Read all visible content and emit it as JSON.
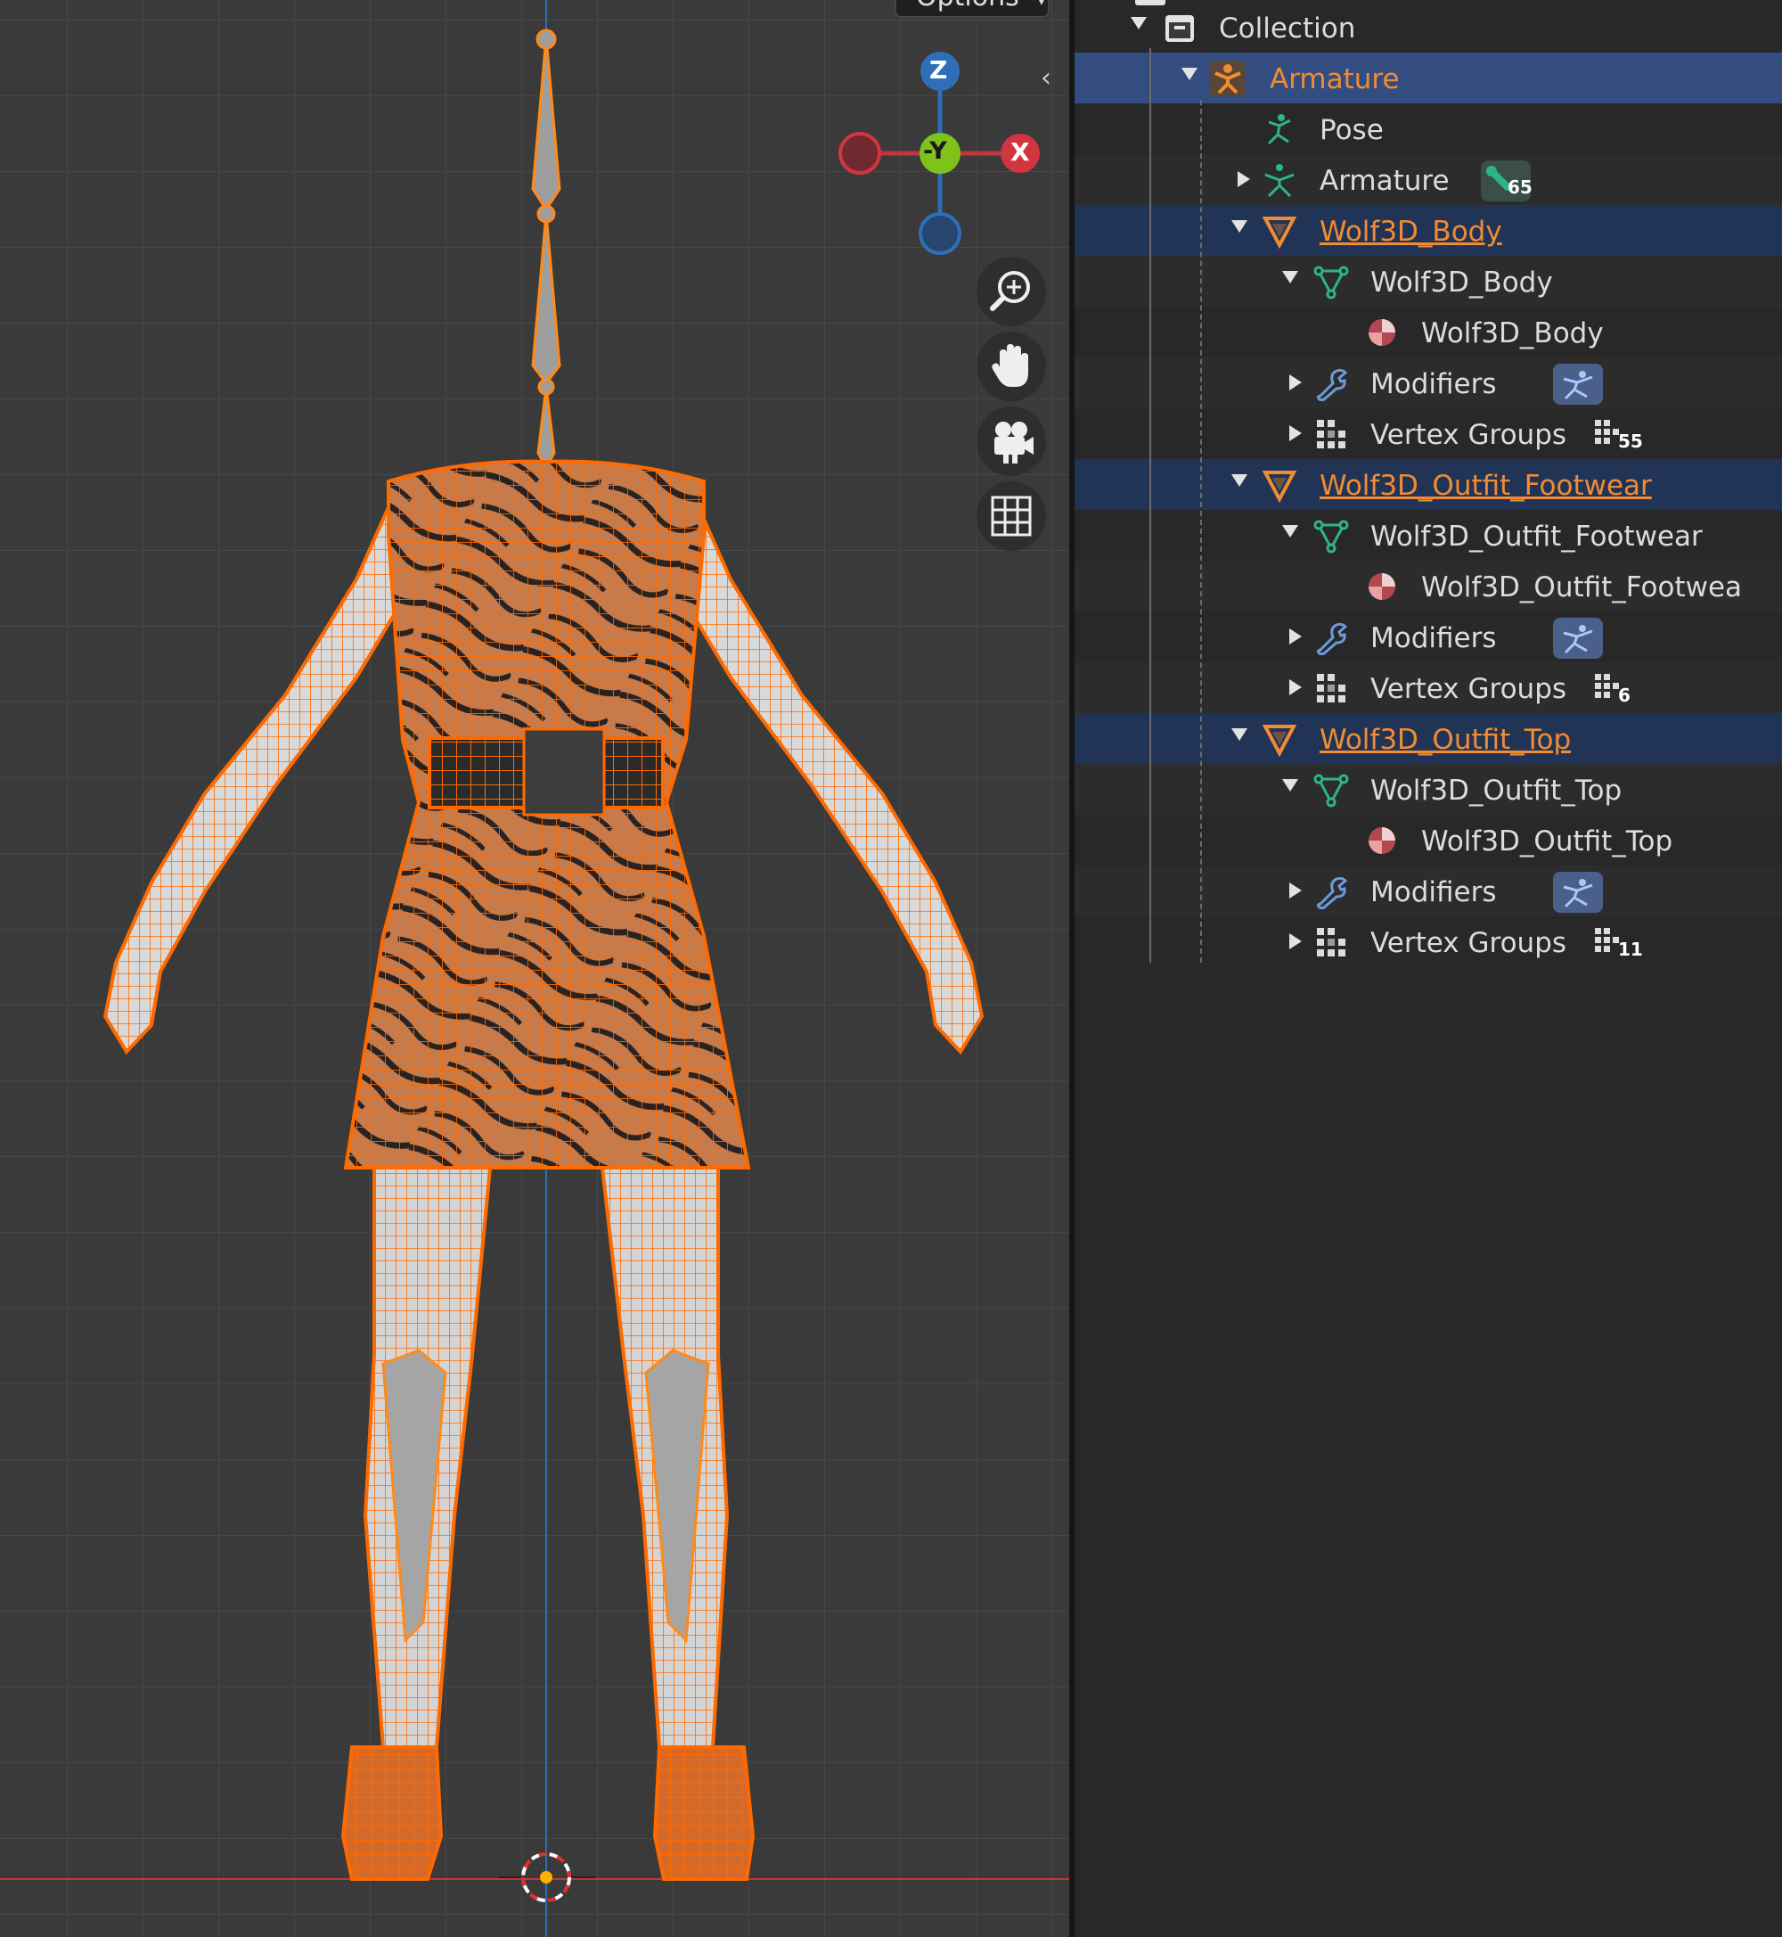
{
  "viewport": {
    "options_label": "Options",
    "axes": {
      "z": "Z",
      "y": "-Y",
      "x": "X"
    },
    "nav_buttons": [
      "zoom-icon",
      "pan-hand-icon",
      "camera-view-icon",
      "grid-ortho-icon"
    ],
    "colors": {
      "grid_bg": "#3a3a3a",
      "grid_line": "#474747",
      "selection": "#ff6a00",
      "x_axis": "#c0353c",
      "z_axis": "#2f6fb8"
    }
  },
  "outliner": {
    "rows": [
      {
        "name": "Collection",
        "icon": "collection-icon",
        "style": "normal"
      },
      {
        "name": "Armature",
        "icon": "armature-object-icon",
        "style": "active"
      },
      {
        "name": "Pose",
        "icon": "pose-icon",
        "style": "normal"
      },
      {
        "name": "Armature",
        "icon": "armature-data-icon",
        "style": "normal",
        "badge": "65"
      },
      {
        "name": "Wolf3D_Body",
        "icon": "mesh-object-icon",
        "style": "selected"
      },
      {
        "name": "Wolf3D_Body",
        "icon": "mesh-data-icon",
        "style": "normal"
      },
      {
        "name": "Wolf3D_Body",
        "icon": "material-icon",
        "style": "normal"
      },
      {
        "name": "Modifiers",
        "icon": "wrench-icon",
        "style": "normal"
      },
      {
        "name": "Vertex Groups",
        "icon": "vertex-groups-icon",
        "style": "normal",
        "badge": "55"
      },
      {
        "name": "Wolf3D_Outfit_Footwear",
        "icon": "mesh-object-icon",
        "style": "selected"
      },
      {
        "name": "Wolf3D_Outfit_Footwear",
        "icon": "mesh-data-icon",
        "style": "normal"
      },
      {
        "name": "Wolf3D_Outfit_Footwea",
        "icon": "material-icon",
        "style": "normal"
      },
      {
        "name": "Modifiers",
        "icon": "wrench-icon",
        "style": "normal"
      },
      {
        "name": "Vertex Groups",
        "icon": "vertex-groups-icon",
        "style": "normal",
        "badge": "6"
      },
      {
        "name": "Wolf3D_Outfit_Top",
        "icon": "mesh-object-icon",
        "style": "selected"
      },
      {
        "name": "Wolf3D_Outfit_Top",
        "icon": "mesh-data-icon",
        "style": "normal"
      },
      {
        "name": "Wolf3D_Outfit_Top",
        "icon": "material-icon",
        "style": "normal"
      },
      {
        "name": "Modifiers",
        "icon": "wrench-icon",
        "style": "normal"
      },
      {
        "name": "Vertex Groups",
        "icon": "vertex-groups-icon",
        "style": "normal",
        "badge": "11"
      }
    ]
  }
}
